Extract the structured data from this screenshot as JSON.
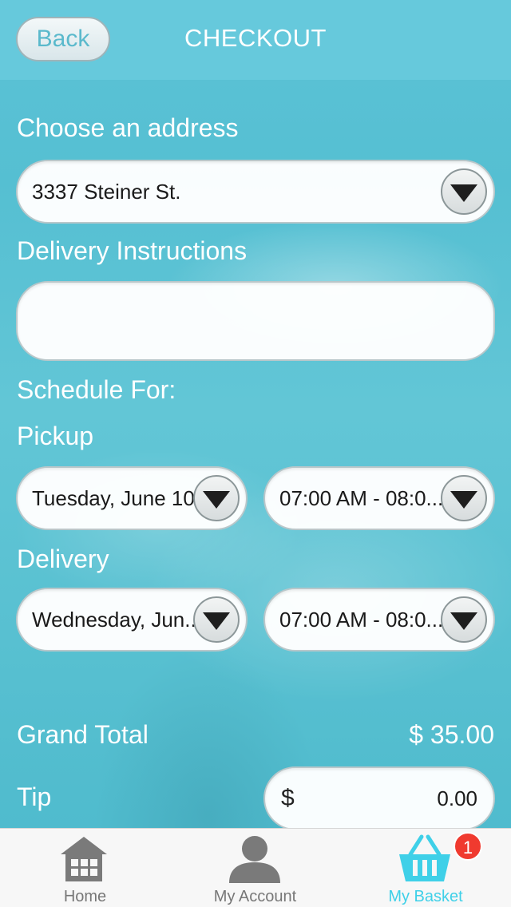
{
  "header": {
    "back_label": "Back",
    "title": "CHECKOUT"
  },
  "address": {
    "label": "Choose an address",
    "selected": "3337 Steiner St."
  },
  "instructions": {
    "label": "Delivery Instructions",
    "value": ""
  },
  "schedule": {
    "label": "Schedule For:",
    "pickup": {
      "label": "Pickup",
      "date": "Tuesday, June 10",
      "time": "07:00 AM - 08:0..."
    },
    "delivery": {
      "label": "Delivery",
      "date": "Wednesday, Jun...",
      "time": "07:00 AM - 08:0..."
    }
  },
  "totals": {
    "grand_total_label": "Grand Total",
    "grand_total_value": "$ 35.00",
    "tip_label": "Tip",
    "tip_currency": "$",
    "tip_value": "0.00"
  },
  "tabbar": {
    "items": [
      {
        "label": "Home",
        "icon": "home-icon",
        "active": false
      },
      {
        "label": "My Account",
        "icon": "person-icon",
        "active": false
      },
      {
        "label": "My Basket",
        "icon": "basket-icon",
        "active": true,
        "badge": "1"
      }
    ]
  },
  "colors": {
    "accent": "#3fd0e8",
    "badge": "#f03a2f",
    "header": "#66c9dc"
  }
}
